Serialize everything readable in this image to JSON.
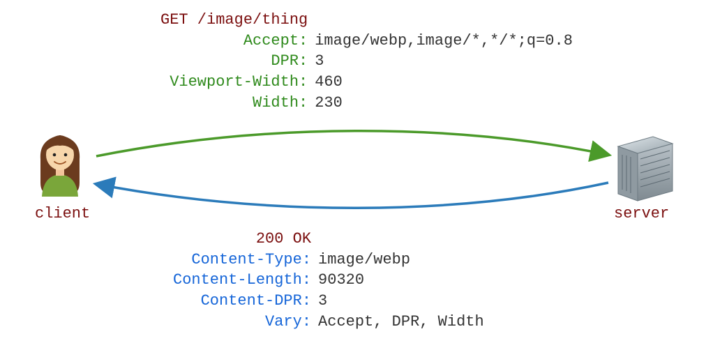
{
  "request": {
    "first_line": "GET /image/thing",
    "headers": [
      {
        "key": "Accept:",
        "value": "image/webp,image/*,*/*;q=0.8"
      },
      {
        "key": "DPR:",
        "value": "3"
      },
      {
        "key": "Viewport-Width:",
        "value": "460"
      },
      {
        "key": "Width:",
        "value": "230"
      }
    ]
  },
  "response": {
    "first_line": "200 OK",
    "headers": [
      {
        "key": "Content-Type:",
        "value": "image/webp"
      },
      {
        "key": "Content-Length:",
        "value": "90320"
      },
      {
        "key": "Content-DPR:",
        "value": "3"
      },
      {
        "key": "Vary:",
        "value": "Accept, DPR, Width"
      }
    ]
  },
  "client_label": "client",
  "server_label": "server",
  "colors": {
    "request_arrow": "#4b9a2a",
    "response_arrow": "#2b7bba"
  }
}
